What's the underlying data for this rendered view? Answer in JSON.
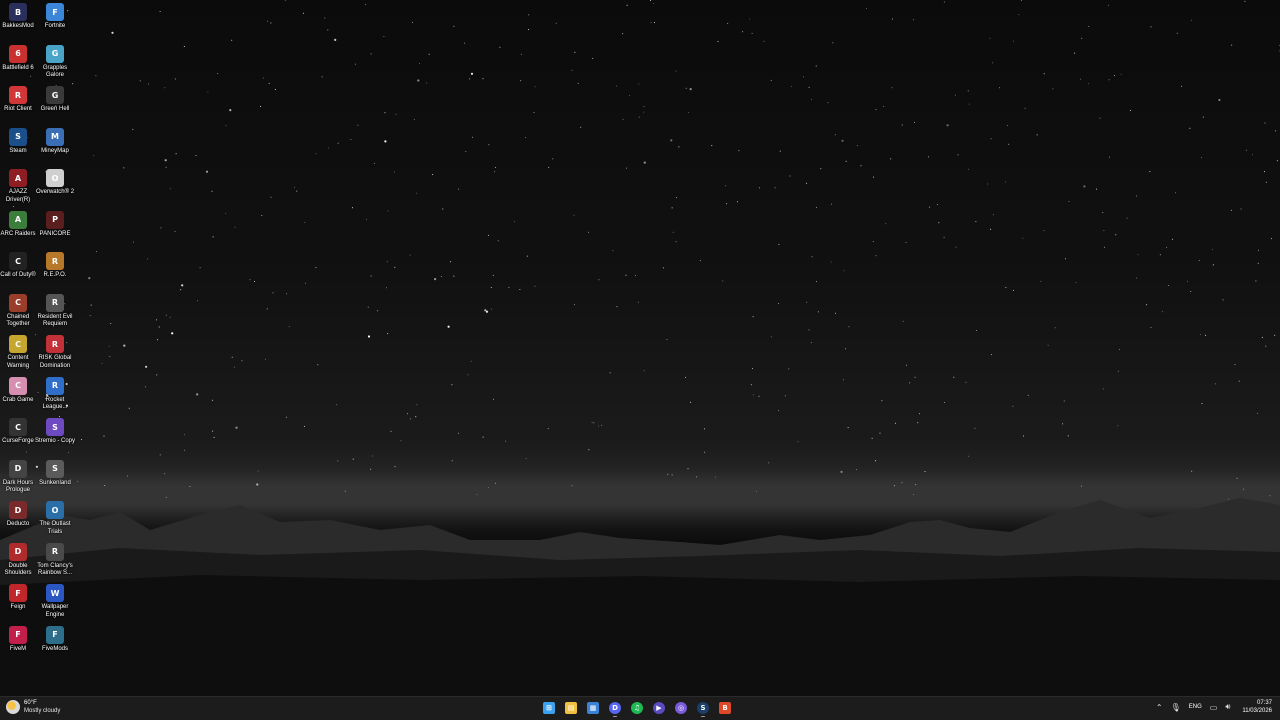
{
  "desktop": {
    "icons": [
      {
        "id": "bakkesmod",
        "label": "BakkesMod",
        "glyph": "B",
        "color": "#2a2f5c"
      },
      {
        "id": "fortnite",
        "label": "Fortnite",
        "glyph": "F",
        "color": "#3b86d8"
      },
      {
        "id": "battlefield-6",
        "label": "Battlefield 6",
        "glyph": "6",
        "color": "#c8312f"
      },
      {
        "id": "grapples-galore",
        "label": "Grapples Galore",
        "glyph": "G",
        "color": "#4aa4c7"
      },
      {
        "id": "riot-client",
        "label": "Riot Client",
        "glyph": "R",
        "color": "#d13639"
      },
      {
        "id": "green-hell",
        "label": "Green Hell",
        "glyph": "G",
        "color": "#3a3a3a"
      },
      {
        "id": "steam",
        "label": "Steam",
        "glyph": "S",
        "color": "#1b4f8a"
      },
      {
        "id": "mineymap",
        "label": "MineyMap",
        "glyph": "M",
        "color": "#3a6fb5"
      },
      {
        "id": "ajazz-driver",
        "label": "AJAZZ Driver(R)",
        "glyph": "A",
        "color": "#8f1d24"
      },
      {
        "id": "overwatch-2",
        "label": "Overwatch® 2",
        "glyph": "O",
        "color": "#cfcfcf"
      },
      {
        "id": "arc-raiders",
        "label": "ARC Raiders",
        "glyph": "A",
        "color": "#3b7d3a"
      },
      {
        "id": "panicore",
        "label": "PANICORE",
        "glyph": "P",
        "color": "#5a1e1e"
      },
      {
        "id": "call-of-duty",
        "label": "Call of Duty®",
        "glyph": "C",
        "color": "#222"
      },
      {
        "id": "repo",
        "label": "R.E.P.O.",
        "glyph": "R",
        "color": "#b7782a"
      },
      {
        "id": "chained-together",
        "label": "Chained Together",
        "glyph": "C",
        "color": "#9a3d2a"
      },
      {
        "id": "resident-evil-requiem",
        "label": "Resident Evil Requiem",
        "glyph": "R",
        "color": "#555"
      },
      {
        "id": "content-warning",
        "label": "Content Warning",
        "glyph": "C",
        "color": "#c7a62f"
      },
      {
        "id": "risk-global-domination",
        "label": "RISK Global Domination",
        "glyph": "R",
        "color": "#c23038"
      },
      {
        "id": "crab-game",
        "label": "Crab Game",
        "glyph": "C",
        "color": "#d68fb0"
      },
      {
        "id": "rocket-league",
        "label": "Rocket League...",
        "glyph": "R",
        "color": "#2f6ec9"
      },
      {
        "id": "curseforge",
        "label": "CurseForge",
        "glyph": "C",
        "color": "#333"
      },
      {
        "id": "stremio-copy",
        "label": "Stremio - Copy",
        "glyph": "S",
        "color": "#6d4ac2"
      },
      {
        "id": "dark-hours-prologue",
        "label": "Dark Hours Prologue",
        "glyph": "D",
        "color": "#444"
      },
      {
        "id": "sunkenland",
        "label": "Sunkenland",
        "glyph": "S",
        "color": "#5b5b5b"
      },
      {
        "id": "deducto",
        "label": "Deducto",
        "glyph": "D",
        "color": "#7a2a2a"
      },
      {
        "id": "outlast-trials",
        "label": "The Outlast Trials",
        "glyph": "O",
        "color": "#2b6fa8"
      },
      {
        "id": "double-shoulders",
        "label": "Double Shoulders",
        "glyph": "D",
        "color": "#b02b2b"
      },
      {
        "id": "rainbow-six",
        "label": "Tom Clancy's Rainbow S...",
        "glyph": "R",
        "color": "#4a4a4a"
      },
      {
        "id": "feign",
        "label": "Feign",
        "glyph": "F",
        "color": "#c0272d"
      },
      {
        "id": "wallpaper-engine",
        "label": "Wallpaper Engine",
        "glyph": "W",
        "color": "#2a57c2"
      },
      {
        "id": "fivem",
        "label": "FiveM",
        "glyph": "F",
        "color": "#c21f4a"
      },
      {
        "id": "fivemods",
        "label": "FiveMods",
        "glyph": "F",
        "color": "#2d6e8a"
      }
    ]
  },
  "taskbar": {
    "weather": {
      "temp": "60°F",
      "condition": "Mostly cloudy"
    },
    "apps": [
      {
        "id": "start",
        "glyph": "⊞",
        "color": "#3aa0f0",
        "running": false
      },
      {
        "id": "file-explorer",
        "glyph": "▤",
        "color": "#f0c040",
        "running": false
      },
      {
        "id": "microsoft-store",
        "glyph": "▦",
        "color": "#3a82d8",
        "running": false
      },
      {
        "id": "discord",
        "glyph": "D",
        "color": "#5865f2",
        "running": true
      },
      {
        "id": "spotify",
        "glyph": "♫",
        "color": "#1db954",
        "running": false
      },
      {
        "id": "app-6",
        "glyph": "▶",
        "color": "#5a4ac2",
        "running": false
      },
      {
        "id": "app-7",
        "glyph": "◎",
        "color": "#7a5ad8",
        "running": false
      },
      {
        "id": "steam",
        "glyph": "S",
        "color": "#1b3f6a",
        "running": true
      },
      {
        "id": "brave",
        "glyph": "B",
        "color": "#e0482a",
        "running": false
      }
    ],
    "tray": {
      "language": "ENG",
      "time": "07:37",
      "date": "11/03/2026"
    }
  }
}
